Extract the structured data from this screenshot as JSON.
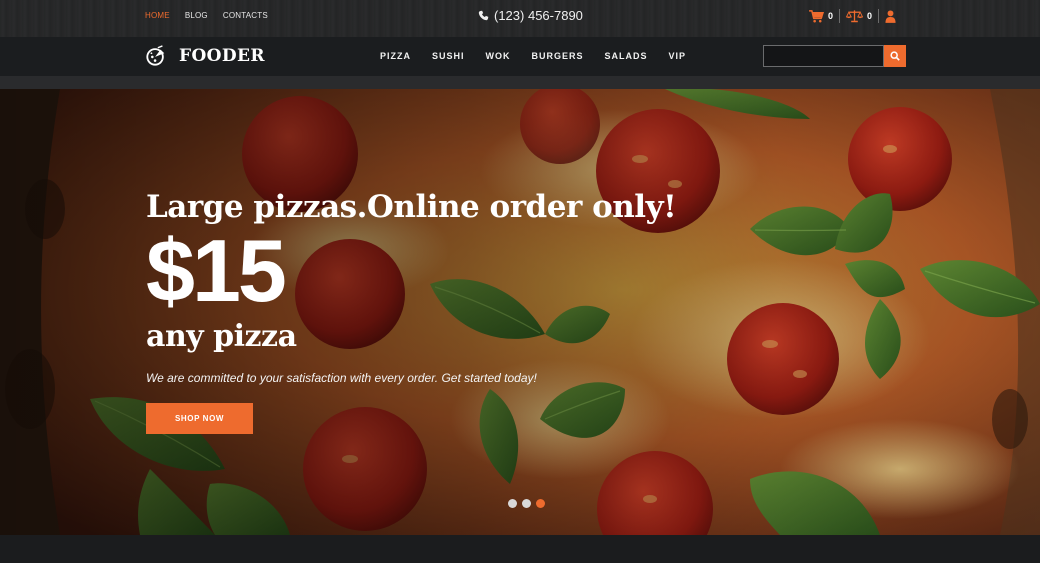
{
  "topbar": {
    "nav": [
      "HOME",
      "BLOG",
      "CONTACTS"
    ],
    "phone": "(123) 456-7890",
    "cart_count": "0",
    "compare_count": "0"
  },
  "header": {
    "brand": "FOODER",
    "menu": [
      "PIZZA",
      "SUSHI",
      "WOK",
      "BURGERS",
      "SALADS",
      "VIP"
    ],
    "search_placeholder": ""
  },
  "hero": {
    "headline": "Large pizzas.Online order only!",
    "price": "$15",
    "sub_headline": "any pizza",
    "tagline": "We are committed to your satisfaction with every order. Get started today!",
    "cta_label": "SHOP NOW",
    "slides_total": 3,
    "active_slide": 3
  },
  "colors": {
    "accent": "#ee6b2e",
    "header_bg": "#1b1d1f",
    "topbar_bg": "#262728"
  }
}
